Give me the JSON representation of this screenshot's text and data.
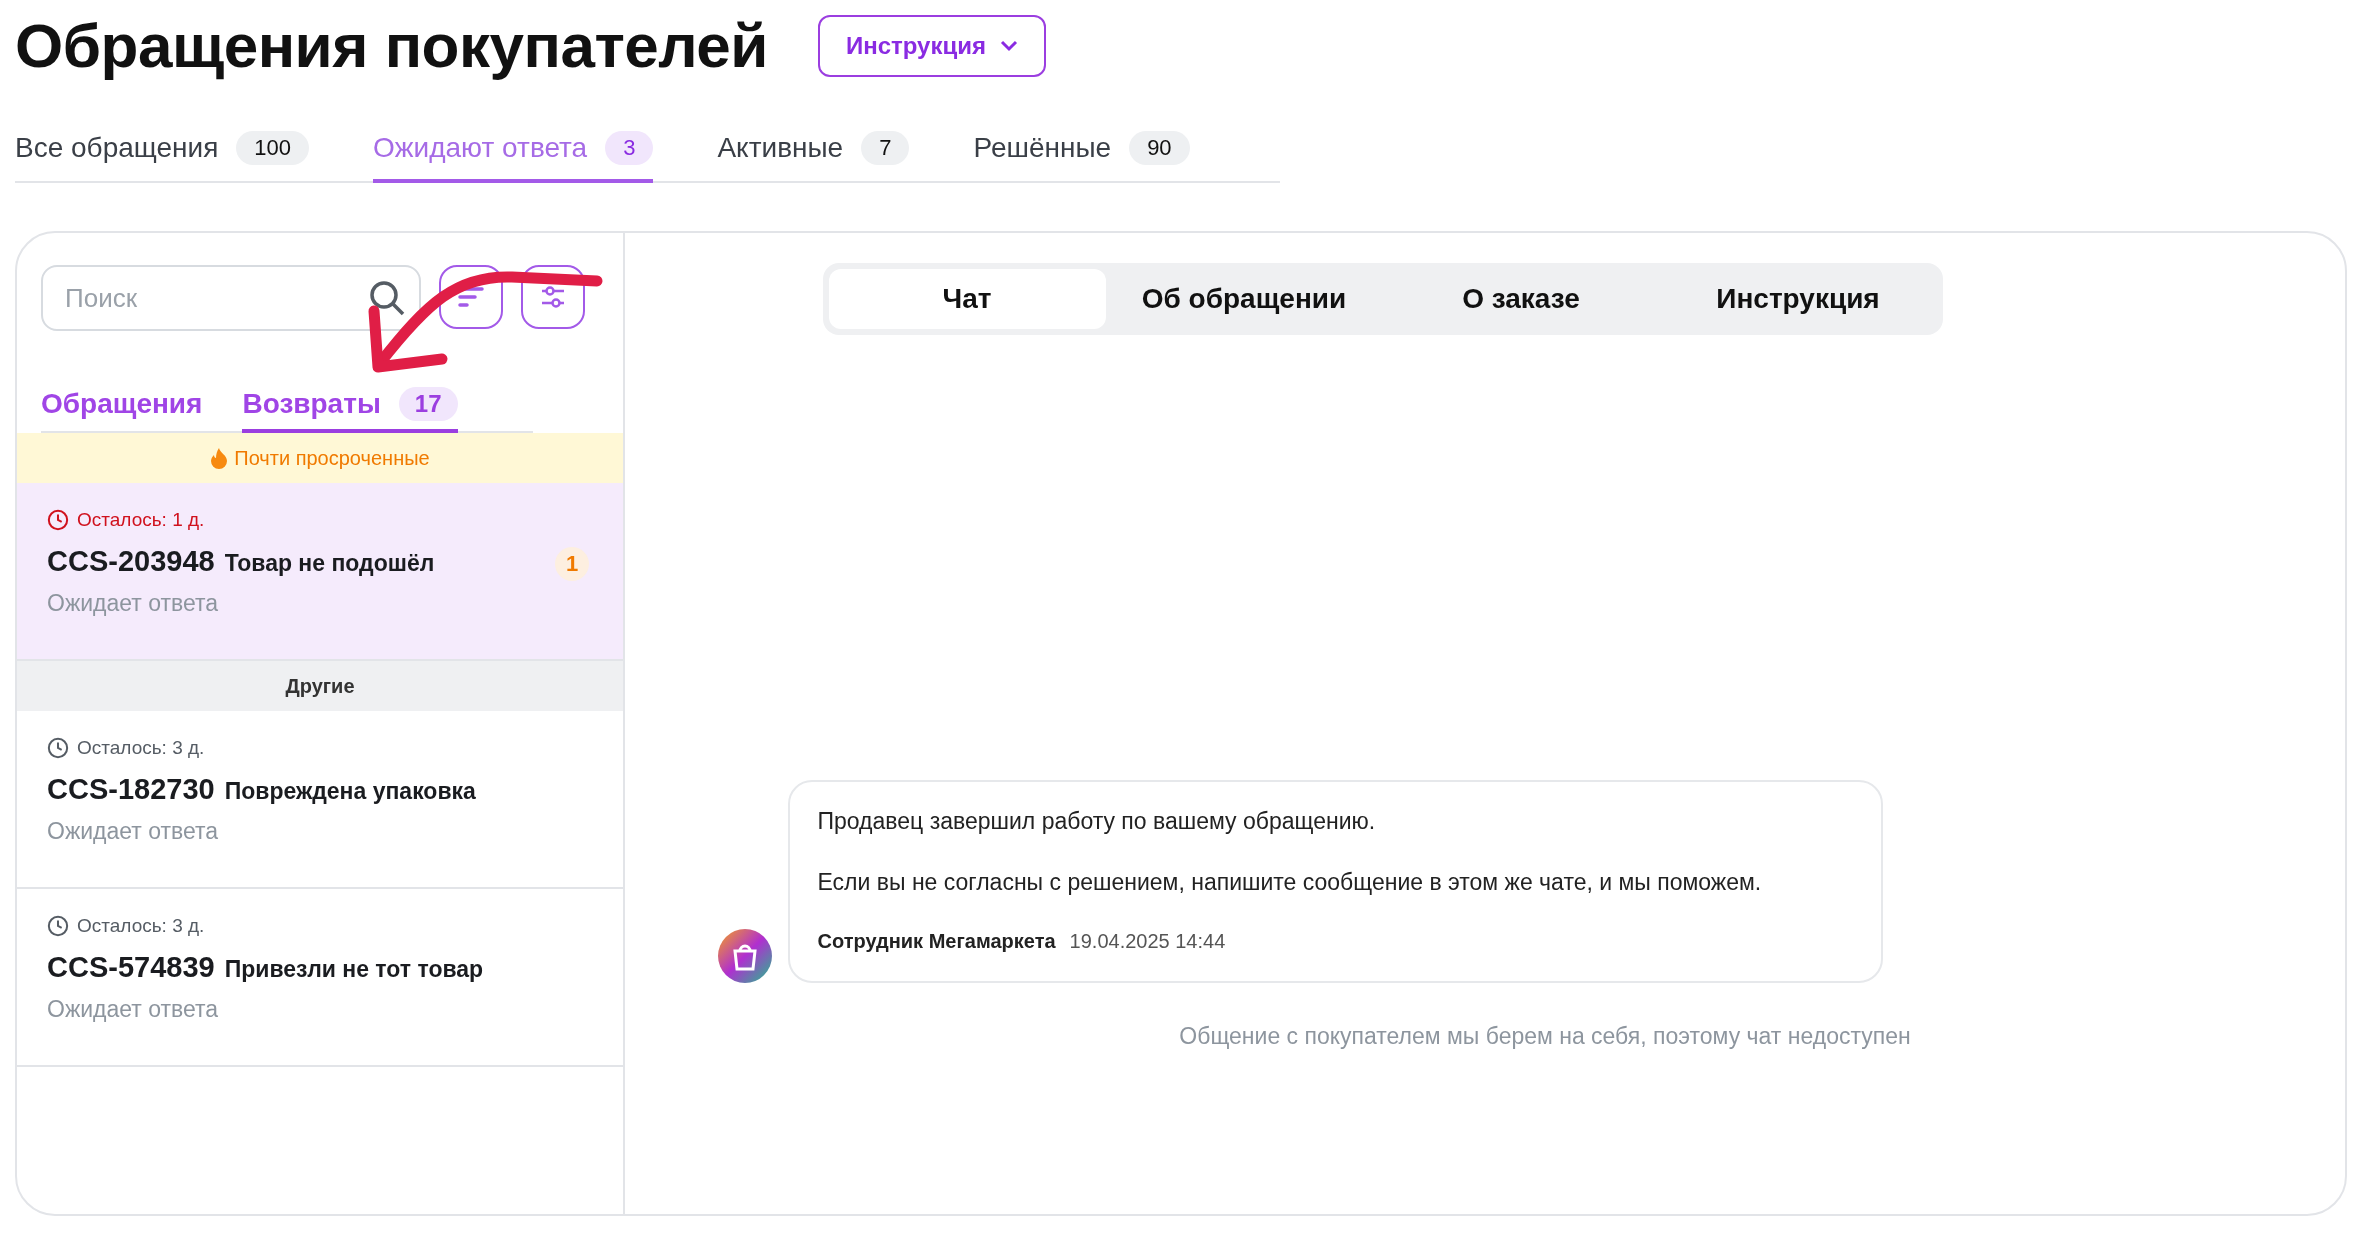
{
  "page": {
    "title": "Обращения покупателей",
    "instruction_button": "Инструкция"
  },
  "status_tabs": [
    {
      "label": "Все обращения",
      "count": "100",
      "selected": false
    },
    {
      "label": "Ожидают ответа",
      "count": "3",
      "selected": true
    },
    {
      "label": "Активные",
      "count": "7",
      "selected": false
    },
    {
      "label": "Решённые",
      "count": "90",
      "selected": false
    }
  ],
  "sidebar": {
    "search": {
      "placeholder": "Поиск"
    },
    "tabs": [
      {
        "label": "Обращения",
        "selected": false
      },
      {
        "label": "Возвраты",
        "count": "17",
        "selected": true
      }
    ],
    "groups": [
      {
        "title": "Почти просроченные",
        "kind": "urgent",
        "tickets": [
          {
            "deadline": "Осталось: 1 д.",
            "id": "CCS-203948",
            "subject": "Товар не подошёл",
            "status": "Ожидает ответа",
            "unread": "1",
            "selected": true
          }
        ]
      },
      {
        "title": "Другие",
        "kind": "normal",
        "tickets": [
          {
            "deadline": "Осталось: 3 д.",
            "id": "CCS-182730",
            "subject": "Повреждена упаковка",
            "status": "Ожидает ответа",
            "selected": false
          },
          {
            "deadline": "Осталось: 3 д.",
            "id": "CCS-574839",
            "subject": "Привезли не тот товар",
            "status": "Ожидает ответа",
            "selected": false
          }
        ]
      }
    ]
  },
  "detail": {
    "tabs": [
      {
        "label": "Чат",
        "selected": true
      },
      {
        "label": "Об обращении",
        "selected": false
      },
      {
        "label": "О заказе",
        "selected": false
      },
      {
        "label": "Инструкция",
        "selected": false
      }
    ],
    "message": {
      "paragraphs": [
        "Продавец завершил работу по вашему обращению.",
        "Если вы не согласны с решением, напишите сообщение в этом же чате, и мы поможем."
      ],
      "author": "Сотрудник Мегамаркета",
      "time": "19.04.2025 14:44"
    },
    "notice": "Общение с покупателем мы берем на себя, поэтому чат недоступен"
  }
}
